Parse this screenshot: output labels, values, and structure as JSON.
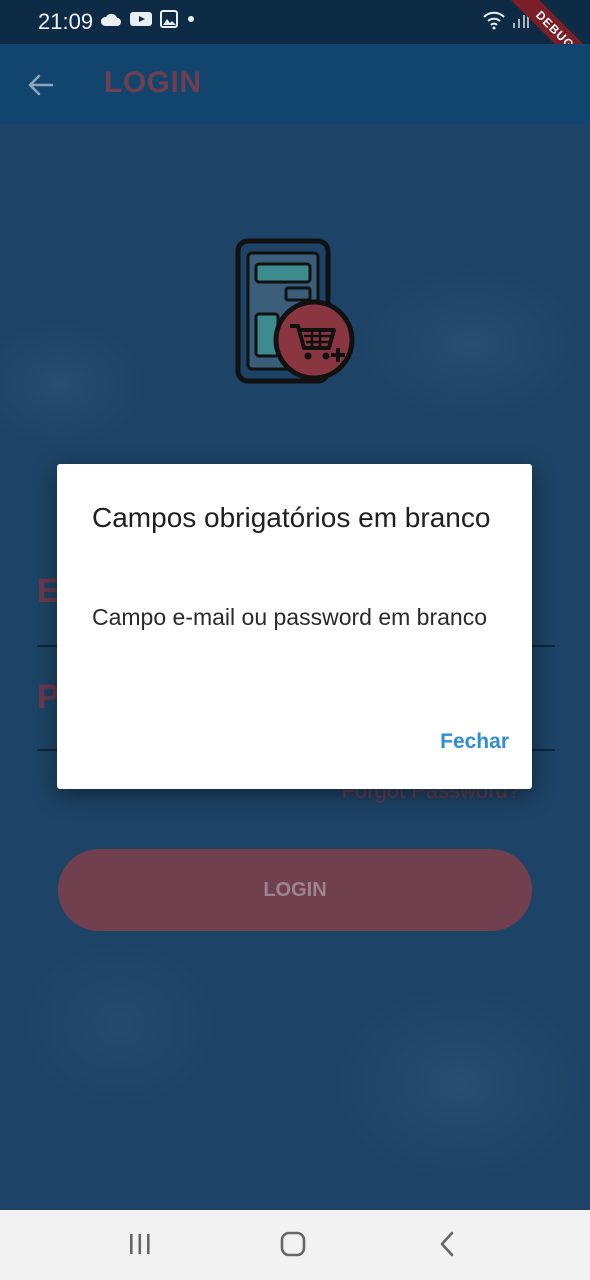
{
  "status_bar": {
    "time": "21:09",
    "debug_label": "DEBUG",
    "icons_left": [
      "cloud-icon",
      "youtube-icon",
      "image-icon",
      "dot-icon"
    ],
    "icons_right": [
      "wifi-icon",
      "signal-icon"
    ]
  },
  "app_bar": {
    "title": "LOGIN",
    "back_icon": "arrow-left-icon"
  },
  "form": {
    "email_label": "E",
    "password_label": "P",
    "forgot_password": "Forgot Password?",
    "login_button": "LOGIN"
  },
  "dialog": {
    "title": "Campos obrigatórios em branco",
    "message": "Campo e-mail ou password em branco",
    "action": "Fechar"
  },
  "colors": {
    "app_bar": "#11456e",
    "accent": "#71404f",
    "dialog_action": "#2f8dd1"
  }
}
